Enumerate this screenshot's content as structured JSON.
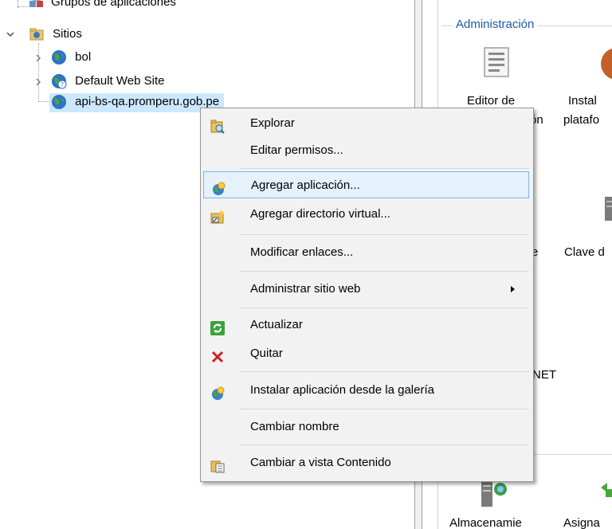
{
  "tree": {
    "app_pools": "Grupos de aplicaciones",
    "sites": "Sitios",
    "site1": "bol",
    "site2": "Default Web Site",
    "site3": "api-bs-qa.promperu.gob.pe"
  },
  "features": {
    "group_title": "Administración",
    "item1_line1": "Editor de",
    "item1_line2": "ón",
    "item2_line1": "Instal",
    "item2_line2": "platafo",
    "item3": "e",
    "item4": "Clave d",
    "item5": "NET",
    "item6": "Almacenamie",
    "item7": "Asigna"
  },
  "menu": {
    "explore": "Explorar",
    "edit_permissions": "Editar permisos...",
    "add_application": "Agregar aplicación...",
    "add_virtual_dir": "Agregar directorio virtual...",
    "edit_bindings": "Modificar enlaces...",
    "manage_website": "Administrar sitio web",
    "refresh": "Actualizar",
    "remove": "Quitar",
    "install_from_gallery": "Instalar aplicación desde la galería",
    "rename": "Cambiar nombre",
    "switch_content_view": "Cambiar a vista Contenido"
  },
  "colors": {
    "highlight": "#e5f1fb",
    "highlight_border": "#7eb4ea",
    "group_title": "#1e5aa8",
    "remove_icon": "#d62020"
  }
}
